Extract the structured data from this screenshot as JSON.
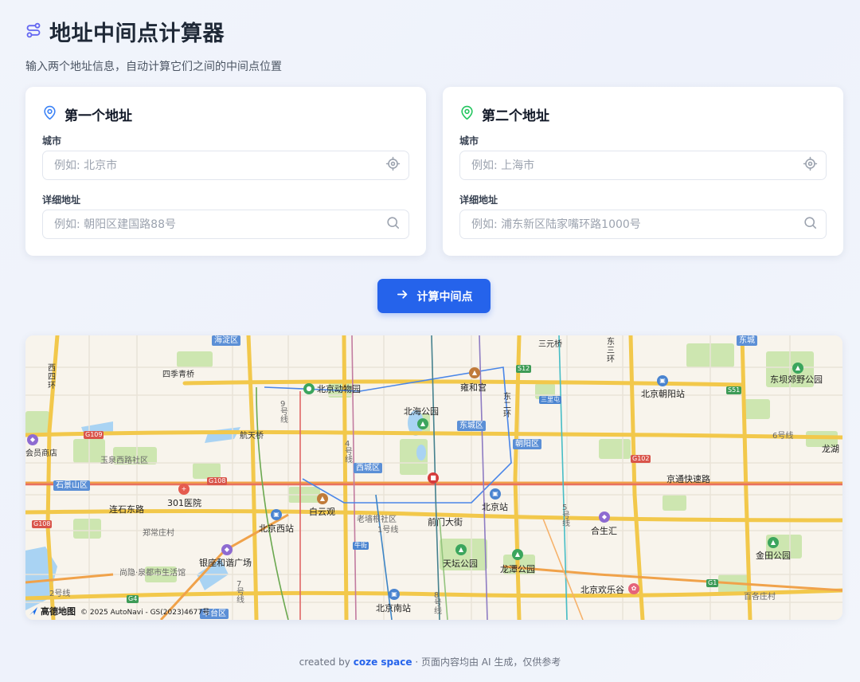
{
  "header": {
    "title": "地址中间点计算器",
    "subtitle": "输入两个地址信息，自动计算它们之间的中间点位置",
    "icon": "route-icon",
    "accent": "#6366f1"
  },
  "first_address": {
    "title": "第一个地址",
    "icon": "map-pin-icon",
    "icon_color": "#3b82f6",
    "city_label": "城市",
    "city_placeholder": "例如: 北京市",
    "city_value": "",
    "detail_label": "详细地址",
    "detail_placeholder": "例如: 朝阳区建国路88号",
    "detail_value": ""
  },
  "second_address": {
    "title": "第二个地址",
    "icon": "map-pin-icon",
    "icon_color": "#22c55e",
    "city_label": "城市",
    "city_placeholder": "例如: 上海市",
    "city_value": "",
    "detail_label": "详细地址",
    "detail_placeholder": "例如: 浦东新区陆家嘴环路1000号",
    "detail_value": ""
  },
  "action": {
    "label": "计算中间点",
    "icon": "arrow-right-icon",
    "color": "#2563eb"
  },
  "map": {
    "districts": [
      "海淀区",
      "东城区",
      "朝阳区",
      "西城区",
      "石景山区",
      "丰台区",
      "东城"
    ],
    "places": [
      "北京动物园",
      "雍和宫",
      "北海公园",
      "四季青桥",
      "航天桥",
      "三元桥",
      "北京朝阳站",
      "东坝郊野公园",
      "会员商店",
      "玉泉西路社区",
      "301医院",
      "连石东路",
      "白云观",
      "北京站",
      "北京西站",
      "郑常庄村",
      "银座和谐广场",
      "天坛公园",
      "龙潭公园",
      "北京南站",
      "合生汇",
      "北京欢乐谷",
      "金田公园",
      "京通快速路",
      "老墙根社区",
      "前门大街",
      "龙湖",
      "尚隐·泉都市生活馆",
      "西四环",
      "东二环",
      "东三环",
      "百各庄村"
    ],
    "roads": [
      "G109",
      "G108",
      "G108",
      "G102",
      "S12",
      "S51",
      "G4",
      "G1",
      "三里屯"
    ],
    "stations": [
      "牛街"
    ],
    "lines": [
      "9号线",
      "4号线",
      "6号线",
      "1号线",
      "7号线",
      "8号线",
      "5号线",
      "2号线"
    ],
    "logo": "高德地图",
    "copyright": "© 2025 AutoNavi - GS(2023)4677号"
  },
  "footer": {
    "prefix": "created by",
    "brand": "coze space",
    "suffix": "· 页面内容均由 AI 生成，仅供参考"
  }
}
